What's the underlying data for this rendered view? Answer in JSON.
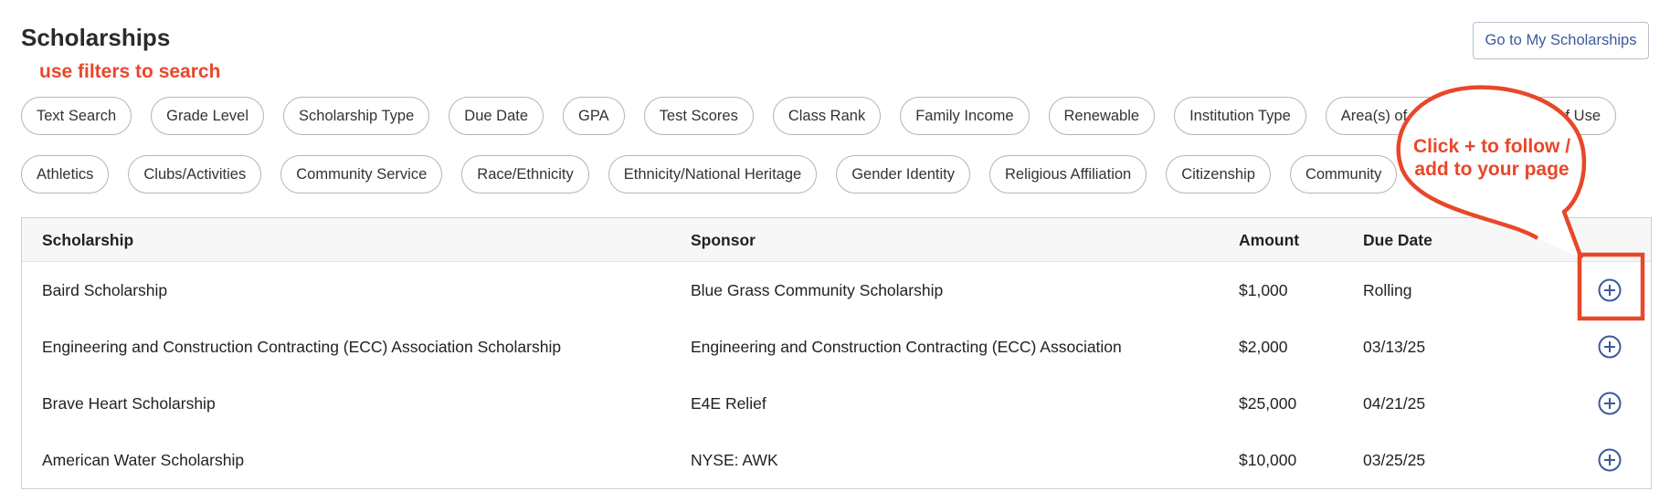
{
  "header": {
    "title": "Scholarships",
    "go_button_label": "Go to My Scholarships"
  },
  "annotations": {
    "hint": "use filters to search",
    "bubble_text": "Click + to follow / add to your page",
    "color": "#e8472a"
  },
  "filters": {
    "row1": [
      "Text Search",
      "Grade Level",
      "Scholarship Type",
      "Due Date",
      "GPA",
      "Test Scores",
      "Class Rank",
      "Family Income",
      "Renewable",
      "Institution Type",
      "Area(s) of Study",
      "State(s) of Use"
    ],
    "row2": [
      "Athletics",
      "Clubs/Activities",
      "Community Service",
      "Race/Ethnicity",
      "Ethnicity/National Heritage",
      "Gender Identity",
      "Religious Affiliation",
      "Citizenship",
      "Community"
    ]
  },
  "table": {
    "columns": {
      "scholarship": "Scholarship",
      "sponsor": "Sponsor",
      "amount": "Amount",
      "due_date": "Due Date"
    },
    "rows": [
      {
        "scholarship": "Baird Scholarship",
        "sponsor": "Blue Grass Community Scholarship",
        "amount": "$1,000",
        "due_date": "Rolling"
      },
      {
        "scholarship": "Engineering and Construction Contracting (ECC) Association Scholarship",
        "sponsor": "Engineering and Construction Contracting (ECC) Association",
        "amount": "$2,000",
        "due_date": "03/13/25"
      },
      {
        "scholarship": "Brave Heart Scholarship",
        "sponsor": "E4E Relief",
        "amount": "$25,000",
        "due_date": "04/21/25"
      },
      {
        "scholarship": "American Water Scholarship",
        "sponsor": "NYSE: AWK",
        "amount": "$10,000",
        "due_date": "03/25/25"
      }
    ],
    "row_action_icon": "plus-circle-icon",
    "accent_color": "#3c5a9a"
  }
}
